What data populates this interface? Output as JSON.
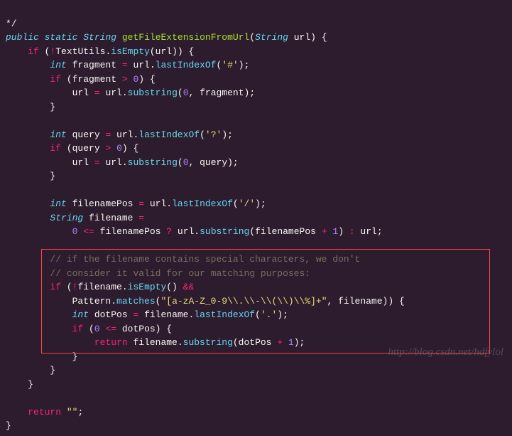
{
  "code": {
    "l01_a": "*/",
    "l02_kw1": "public",
    "l02_kw2": "static",
    "l02_type": "String",
    "l02_fn": "getFileExtensionFromUrl",
    "l02_p": "(",
    "l02_ptype": "String",
    "l02_pname": " url) {",
    "l03_if": "if",
    "l03_a": " (",
    "l03_op": "!",
    "l03_b": "TextUtils.",
    "l03_m": "isEmpty",
    "l03_c": "(url)) {",
    "l04_int": "int",
    "l04_a": " fragment ",
    "l04_op": "=",
    "l04_b": " url.",
    "l04_m": "lastIndexOf",
    "l04_c": "(",
    "l04_str": "'#'",
    "l04_d": ");",
    "l05_if": "if",
    "l05_a": " (fragment ",
    "l05_op": ">",
    "l05_sp": " ",
    "l05_num": "0",
    "l05_b": ") {",
    "l06_a": "url ",
    "l06_op": "=",
    "l06_b": " url.",
    "l06_m": "substring",
    "l06_c": "(",
    "l06_num": "0",
    "l06_d": ", fragment);",
    "l07_a": "}",
    "l09_int": "int",
    "l09_a": " query ",
    "l09_op": "=",
    "l09_b": " url.",
    "l09_m": "lastIndexOf",
    "l09_c": "(",
    "l09_str": "'?'",
    "l09_d": ");",
    "l10_if": "if",
    "l10_a": " (query ",
    "l10_op": ">",
    "l10_sp": " ",
    "l10_num": "0",
    "l10_b": ") {",
    "l11_a": "url ",
    "l11_op": "=",
    "l11_b": " url.",
    "l11_m": "substring",
    "l11_c": "(",
    "l11_num": "0",
    "l11_d": ", query);",
    "l12_a": "}",
    "l14_int": "int",
    "l14_a": " filenamePos ",
    "l14_op": "=",
    "l14_b": " url.",
    "l14_m": "lastIndexOf",
    "l14_c": "(",
    "l14_str": "'/'",
    "l14_d": ");",
    "l15_type": "String",
    "l15_a": " filename ",
    "l15_op": "=",
    "l16_num1": "0",
    "l16_a": " ",
    "l16_op1": "<=",
    "l16_b": " filenamePos ",
    "l16_op2": "?",
    "l16_c": " url.",
    "l16_m": "substring",
    "l16_d": "(filenamePos ",
    "l16_op3": "+",
    "l16_sp": " ",
    "l16_num2": "1",
    "l16_e": ") ",
    "l16_op4": ":",
    "l16_f": " url;",
    "l18_c": "// if the filename contains special characters, we don't",
    "l19_c": "// consider it valid for our matching purposes:",
    "l20_if": "if",
    "l20_a": " (",
    "l20_op": "!",
    "l20_b": "filename.",
    "l20_m": "isEmpty",
    "l20_c": "() ",
    "l20_op2": "&&",
    "l21_a": "Pattern.",
    "l21_m": "matches",
    "l21_b": "(",
    "l21_str": "\"[a-zA-Z_0-9\\\\.\\\\-\\\\(\\\\)\\\\%]+\"",
    "l21_c": ", filename)) {",
    "l22_int": "int",
    "l22_a": " dotPos ",
    "l22_op": "=",
    "l22_b": " filename.",
    "l22_m": "lastIndexOf",
    "l22_c": "(",
    "l22_str": "'.'",
    "l22_d": ");",
    "l23_if": "if",
    "l23_a": " (",
    "l23_num": "0",
    "l23_sp": " ",
    "l23_op": "<=",
    "l23_b": " dotPos) {",
    "l24_ret": "return",
    "l24_a": " filename.",
    "l24_m": "substring",
    "l24_b": "(dotPos ",
    "l24_op": "+",
    "l24_sp": " ",
    "l24_num": "1",
    "l24_c": ");",
    "l25_a": "}",
    "l26_a": "}",
    "l27_a": "}",
    "l29_ret": "return",
    "l29_sp": " ",
    "l29_str": "\"\"",
    "l29_a": ";",
    "l30_a": "}"
  },
  "watermark": "http://blog.csdn.net/hdfylol"
}
